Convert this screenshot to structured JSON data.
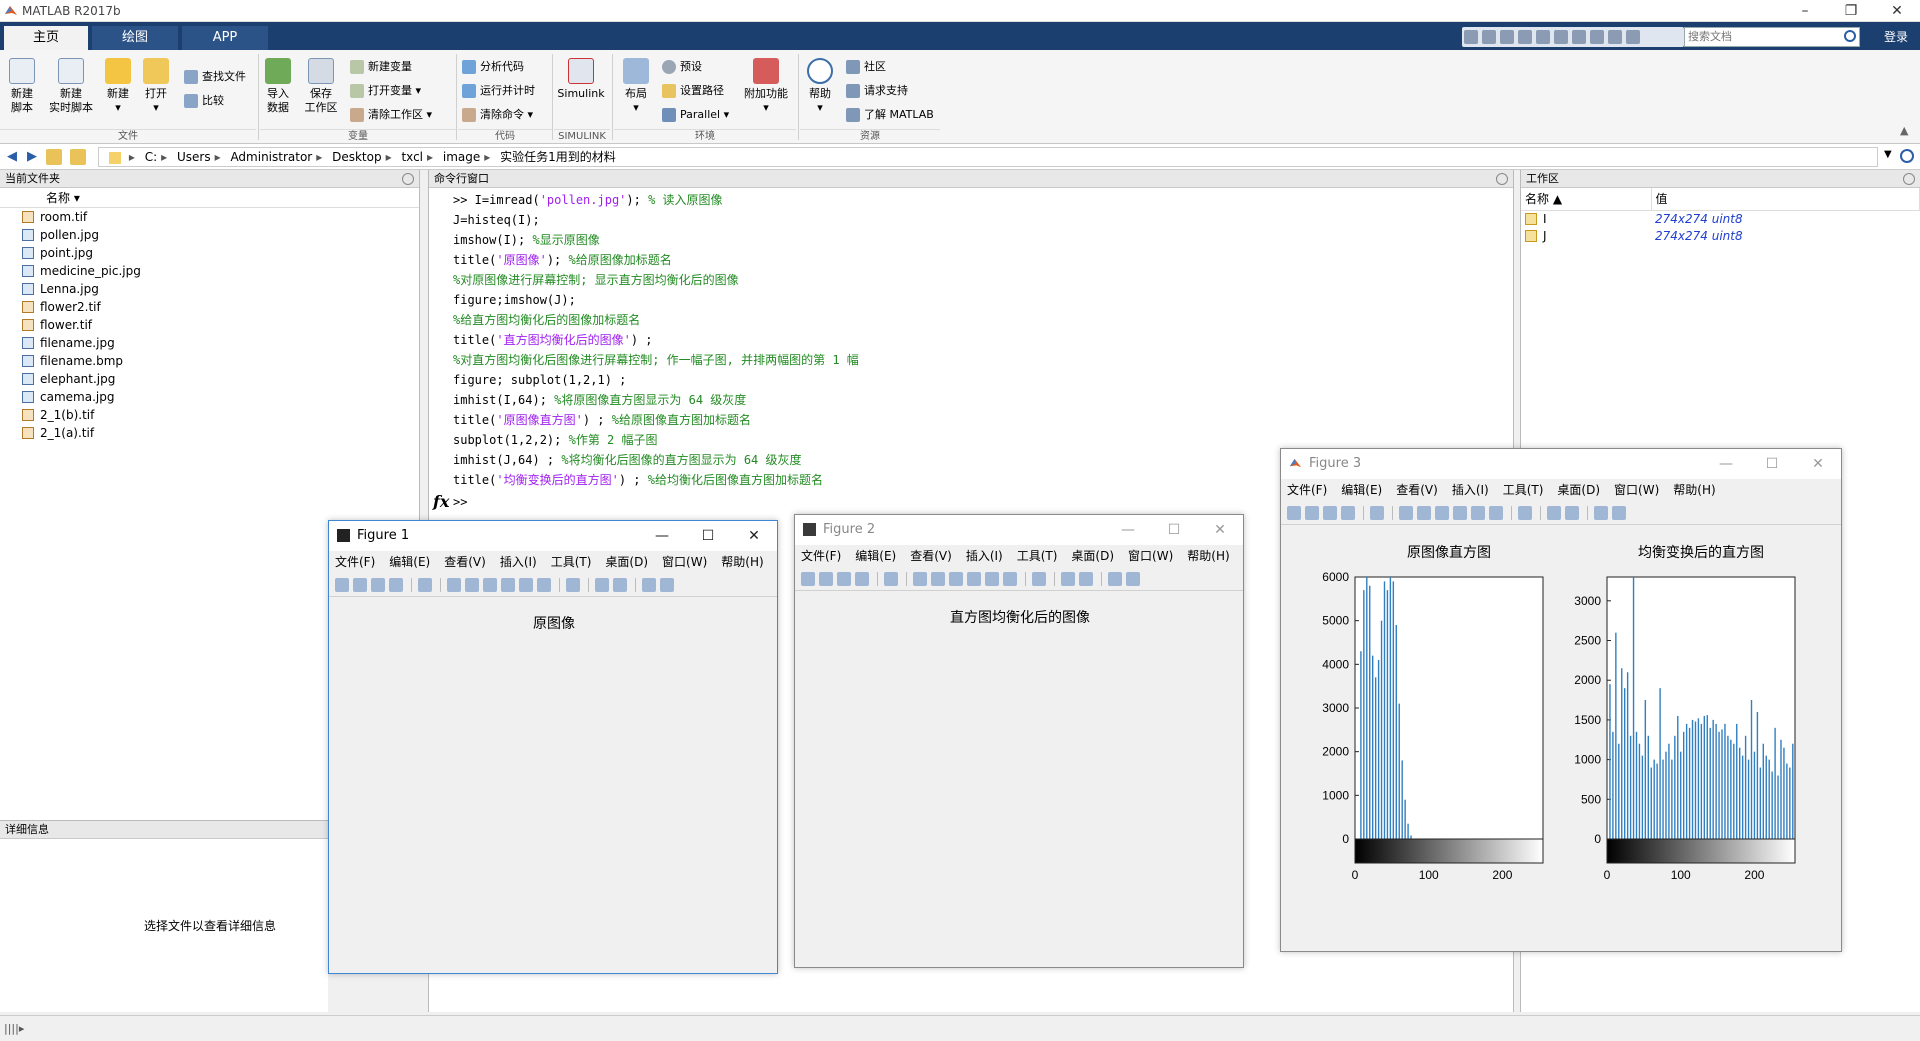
{
  "app": {
    "title": "MATLAB R2017b",
    "tabs": [
      "主页",
      "绘图",
      "APP"
    ],
    "search_placeholder": "搜索文档",
    "login": "登录"
  },
  "ribbon": {
    "file": {
      "new_script": "新建\n脚本",
      "new_live": "新建\n实时脚本",
      "new": "新建",
      "open": "打开",
      "find_files": "查找文件",
      "compare": "比较",
      "label": "文件"
    },
    "variable": {
      "import": "导入\n数据",
      "save_ws": "保存\n工作区",
      "new_var": "新建变量",
      "open_var": "打开变量",
      "clear_ws": "清除工作区",
      "label": "变量"
    },
    "code": {
      "analyze": "分析代码",
      "run_time": "运行并计时",
      "clear_cmd": "清除命令",
      "label": "代码"
    },
    "simulink": {
      "btn": "Simulink",
      "label": "SIMULINK"
    },
    "env": {
      "layout": "布局",
      "prefs": "预设",
      "set_path": "设置路径",
      "parallel": "Parallel",
      "addons": "附加功能",
      "label": "环境"
    },
    "resources": {
      "help": "帮助",
      "community": "社区",
      "support": "请求支持",
      "learn": "了解 MATLAB",
      "label": "资源"
    }
  },
  "path": [
    "C:",
    "Users",
    "Administrator",
    "Desktop",
    "txcl",
    "image",
    "实验任务1用到的材料"
  ],
  "files_panel": {
    "title": "当前文件夹",
    "column": "名称",
    "files": [
      {
        "name": "room.tif",
        "type": "tif"
      },
      {
        "name": "pollen.jpg",
        "type": "jpg"
      },
      {
        "name": "point.jpg",
        "type": "jpg"
      },
      {
        "name": "medicine_pic.jpg",
        "type": "jpg"
      },
      {
        "name": "Lenna.jpg",
        "type": "jpg"
      },
      {
        "name": "flower2.tif",
        "type": "tif"
      },
      {
        "name": "flower.tif",
        "type": "tif"
      },
      {
        "name": "filename.jpg",
        "type": "jpg"
      },
      {
        "name": "filename.bmp",
        "type": "jpg"
      },
      {
        "name": "elephant.jpg",
        "type": "jpg"
      },
      {
        "name": "camema.jpg",
        "type": "jpg"
      },
      {
        "name": "2_1(b).tif",
        "type": "tif"
      },
      {
        "name": "2_1(a).tif",
        "type": "tif"
      }
    ]
  },
  "details_panel": {
    "title": "详细信息",
    "message": "选择文件以查看详细信息"
  },
  "command_window": {
    "title": "命令行窗口",
    "lines": [
      [
        {
          "t": ">> I=imread(",
          "k": "n"
        },
        {
          "t": "'pollen.jpg'",
          "k": "s"
        },
        {
          "t": "); ",
          "k": "n"
        },
        {
          "t": "% 读入原图像",
          "k": "c"
        }
      ],
      [
        {
          "t": "J=histeq(I);",
          "k": "n"
        }
      ],
      [
        {
          "t": "imshow(I); ",
          "k": "n"
        },
        {
          "t": "%显示原图像",
          "k": "c"
        }
      ],
      [
        {
          "t": "title(",
          "k": "n"
        },
        {
          "t": "'原图像'",
          "k": "s"
        },
        {
          "t": "); ",
          "k": "n"
        },
        {
          "t": "%给原图像加标题名",
          "k": "c"
        }
      ],
      [
        {
          "t": "%对原图像进行屏幕控制; 显示直方图均衡化后的图像",
          "k": "c"
        }
      ],
      [
        {
          "t": "figure;imshow(J);",
          "k": "n"
        }
      ],
      [
        {
          "t": "%给直方图均衡化后的图像加标题名",
          "k": "c"
        }
      ],
      [
        {
          "t": "title(",
          "k": "n"
        },
        {
          "t": "'直方图均衡化后的图像'",
          "k": "s"
        },
        {
          "t": ") ;",
          "k": "n"
        }
      ],
      [
        {
          "t": "%对直方图均衡化后图像进行屏幕控制; 作一幅子图, 并排两幅图的第 1 幅",
          "k": "c"
        }
      ],
      [
        {
          "t": "figure; subplot(1,2,1) ;",
          "k": "n"
        }
      ],
      [
        {
          "t": "imhist(I,64); ",
          "k": "n"
        },
        {
          "t": "%将原图像直方图显示为 64 级灰度",
          "k": "c"
        }
      ],
      [
        {
          "t": "title(",
          "k": "n"
        },
        {
          "t": "'原图像直方图'",
          "k": "s"
        },
        {
          "t": ") ; ",
          "k": "n"
        },
        {
          "t": "%给原图像直方图加标题名",
          "k": "c"
        }
      ],
      [
        {
          "t": "subplot(1,2,2); ",
          "k": "n"
        },
        {
          "t": "%作第 2 幅子图",
          "k": "c"
        }
      ],
      [
        {
          "t": "imhist(J,64) ; ",
          "k": "n"
        },
        {
          "t": "%将均衡化后图像的直方图显示为 64 级灰度",
          "k": "c"
        }
      ],
      [
        {
          "t": "title(",
          "k": "n"
        },
        {
          "t": "'均衡变换后的直方图'",
          "k": "s"
        },
        {
          "t": ") ; ",
          "k": "n"
        },
        {
          "t": "%给均衡化后图像直方图加标题名",
          "k": "c"
        }
      ]
    ],
    "prompt": ">>",
    "fx": "fx"
  },
  "workspace": {
    "title": "工作区",
    "col_name": "名称 ▲",
    "col_value": "值",
    "vars": [
      {
        "name": "I",
        "value": "274x274 uint8"
      },
      {
        "name": "J",
        "value": "274x274 uint8"
      }
    ]
  },
  "figure_menu": [
    "文件(F)",
    "编辑(E)",
    "查看(V)",
    "插入(I)",
    "工具(T)",
    "桌面(D)",
    "窗口(W)",
    "帮助(H)"
  ],
  "figures": [
    {
      "title": "Figure 1",
      "axes_title": "原图像",
      "contrast": "dark"
    },
    {
      "title": "Figure 2",
      "axes_title": "直方图均衡化后的图像",
      "contrast": "equalized"
    },
    {
      "title": "Figure 3"
    }
  ],
  "chart_data": [
    {
      "type": "bar",
      "title": "原图像直方图",
      "xlabel": "",
      "ylabel": "",
      "xlim": [
        0,
        255
      ],
      "ylim": [
        0,
        6000
      ],
      "xticks": [
        0,
        100,
        200
      ],
      "yticks": [
        0,
        1000,
        2000,
        3000,
        4000,
        5000,
        6000
      ],
      "x": [
        8,
        12,
        16,
        20,
        24,
        28,
        32,
        36,
        40,
        44,
        48,
        52,
        56,
        60,
        64,
        68,
        72,
        76
      ],
      "values": [
        4300,
        5700,
        6100,
        5800,
        4200,
        3700,
        4100,
        5000,
        5900,
        5700,
        6000,
        5900,
        4900,
        3100,
        1800,
        900,
        350,
        80
      ],
      "colorbar": "grayscale"
    },
    {
      "type": "bar",
      "title": "均衡变换后的直方图",
      "xlabel": "",
      "ylabel": "",
      "xlim": [
        0,
        255
      ],
      "ylim": [
        0,
        3300
      ],
      "xticks": [
        0,
        100,
        200
      ],
      "yticks": [
        0,
        500,
        1000,
        1500,
        2000,
        2500,
        3000
      ],
      "x": [
        4,
        8,
        12,
        16,
        20,
        24,
        28,
        32,
        36,
        40,
        44,
        48,
        52,
        56,
        60,
        64,
        68,
        72,
        76,
        80,
        84,
        88,
        92,
        96,
        100,
        104,
        108,
        112,
        116,
        120,
        124,
        128,
        132,
        136,
        140,
        144,
        148,
        152,
        156,
        160,
        164,
        168,
        172,
        176,
        180,
        184,
        188,
        192,
        196,
        200,
        204,
        208,
        212,
        216,
        220,
        224,
        228,
        232,
        236,
        240,
        244,
        248,
        252
      ],
      "values": [
        1950,
        1350,
        2600,
        1200,
        2150,
        1900,
        2100,
        1300,
        3300,
        1350,
        1200,
        1050,
        1750,
        1300,
        900,
        1000,
        950,
        1900,
        1000,
        1100,
        1200,
        1000,
        1300,
        1550,
        1100,
        1350,
        1450,
        1400,
        1500,
        1480,
        1520,
        1450,
        1550,
        1560,
        1400,
        1500,
        1450,
        1350,
        1380,
        1450,
        1300,
        1250,
        1200,
        1450,
        1150,
        1050,
        1300,
        1000,
        1750,
        1100,
        1600,
        900,
        1200,
        1050,
        1000,
        850,
        1400,
        800,
        1250,
        1150,
        950,
        900,
        1200
      ],
      "colorbar": "grayscale"
    }
  ]
}
